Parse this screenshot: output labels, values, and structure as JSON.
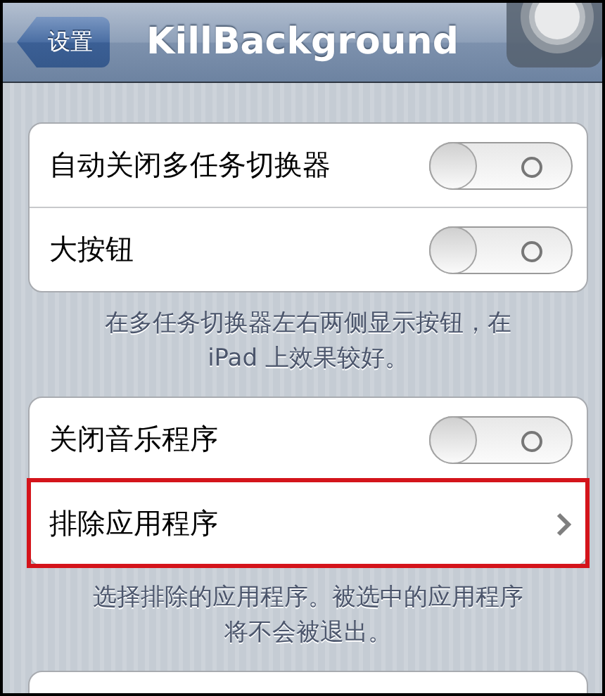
{
  "nav": {
    "back": "设置",
    "title": "KillBackground"
  },
  "groups": [
    {
      "rows": [
        {
          "kind": "toggle",
          "label": "自动关闭多任务切换器",
          "on": false
        },
        {
          "kind": "toggle",
          "label": "大按钮",
          "on": false
        }
      ],
      "footer": [
        "在多任务切换器左右两侧显示按钮，在",
        "iPad 上效果较好。"
      ]
    },
    {
      "rows": [
        {
          "kind": "toggle",
          "label": "关闭音乐程序",
          "on": false
        },
        {
          "kind": "link",
          "label": "排除应用程序",
          "highlighted": true
        }
      ],
      "footer": [
        "选择排除的应用程序。被选中的应用程序",
        "将不会被退出。"
      ]
    }
  ]
}
